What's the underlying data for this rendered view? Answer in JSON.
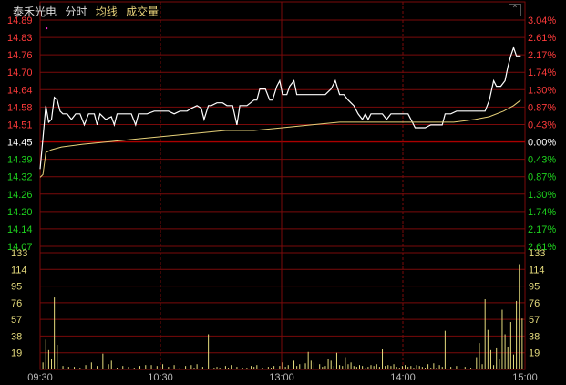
{
  "header": {
    "stock_name": "泰禾光电",
    "mode_label": "分时",
    "avg_label": "均线",
    "vol_label": "成交量",
    "collapse_icon": "chevron-up-icon"
  },
  "colors": {
    "up": "#ff3b3b",
    "down": "#1ed21e",
    "price": "#ffffff",
    "avg": "#e8d27a",
    "vol": "#e6dc7d",
    "grid": "#7a0a0a",
    "dot": "#ff2bd6"
  },
  "chart_data": [
    {
      "type": "line",
      "title": "",
      "ylim": [
        14.01,
        14.89
      ],
      "base": 14.45,
      "price_ticks": [
        "14.89",
        "14.83",
        "14.76",
        "14.70",
        "14.64",
        "14.58",
        "14.51",
        "14.45",
        "14.39",
        "14.32",
        "14.26",
        "14.20",
        "14.14",
        "14.07"
      ],
      "pct_ticks": [
        "3.04%",
        "2.61%",
        "2.17%",
        "1.74%",
        "1.30%",
        "0.87%",
        "0.43%",
        "0.00%",
        "0.43%",
        "0.87%",
        "1.30%",
        "1.74%",
        "2.17%",
        "2.61%"
      ],
      "time_ticks": [
        "09:30",
        "10:30",
        "13:00",
        "14:00",
        "15:00"
      ],
      "series": [
        {
          "name": "",
          "points": [
            [
              0,
              14.35
            ],
            [
              2,
              14.46
            ],
            [
              4,
              14.58
            ],
            [
              6,
              14.52
            ],
            [
              8,
              14.53
            ],
            [
              10,
              14.61
            ],
            [
              12,
              14.6
            ],
            [
              14,
              14.56
            ],
            [
              16,
              14.55
            ],
            [
              19,
              14.55
            ],
            [
              22,
              14.53
            ],
            [
              25,
              14.55
            ],
            [
              28,
              14.55
            ],
            [
              31,
              14.51
            ],
            [
              34,
              14.55
            ],
            [
              38,
              14.55
            ],
            [
              40,
              14.51
            ],
            [
              42,
              14.55
            ],
            [
              46,
              14.53
            ],
            [
              50,
              14.54
            ],
            [
              52,
              14.51
            ],
            [
              54,
              14.55
            ],
            [
              60,
              14.55
            ],
            [
              64,
              14.55
            ],
            [
              67,
              14.51
            ],
            [
              69,
              14.55
            ],
            [
              75,
              14.55
            ],
            [
              80,
              14.56
            ],
            [
              84,
              14.56
            ],
            [
              90,
              14.56
            ],
            [
              94,
              14.55
            ],
            [
              98,
              14.56
            ],
            [
              103,
              14.56
            ],
            [
              106,
              14.57
            ],
            [
              110,
              14.58
            ],
            [
              113,
              14.57
            ],
            [
              115,
              14.53
            ],
            [
              118,
              14.58
            ],
            [
              120,
              14.58
            ],
            [
              124,
              14.59
            ],
            [
              128,
              14.59
            ],
            [
              131,
              14.58
            ],
            [
              135,
              14.58
            ],
            [
              138,
              14.51
            ],
            [
              140,
              14.58
            ],
            [
              145,
              14.58
            ],
            [
              150,
              14.6
            ],
            [
              152,
              14.6
            ],
            [
              154,
              14.64
            ],
            [
              158,
              14.64
            ],
            [
              161,
              14.6
            ],
            [
              163,
              14.6
            ],
            [
              166,
              14.65
            ],
            [
              168,
              14.67
            ],
            [
              170,
              14.62
            ],
            [
              173,
              14.62
            ],
            [
              175,
              14.65
            ],
            [
              178,
              14.67
            ],
            [
              180,
              14.62
            ],
            [
              182,
              14.62
            ],
            [
              186,
              14.62
            ],
            [
              190,
              14.62
            ],
            [
              195,
              14.62
            ],
            [
              200,
              14.62
            ],
            [
              204,
              14.64
            ],
            [
              207,
              14.67
            ],
            [
              210,
              14.62
            ],
            [
              213,
              14.62
            ],
            [
              216,
              14.6
            ],
            [
              220,
              14.58
            ],
            [
              223,
              14.55
            ],
            [
              226,
              14.53
            ],
            [
              228,
              14.55
            ],
            [
              230,
              14.53
            ],
            [
              232,
              14.55
            ],
            [
              235,
              14.55
            ],
            [
              240,
              14.55
            ],
            [
              243,
              14.53
            ],
            [
              246,
              14.55
            ],
            [
              250,
              14.55
            ],
            [
              254,
              14.55
            ],
            [
              258,
              14.55
            ],
            [
              261,
              14.52
            ],
            [
              263,
              14.5
            ],
            [
              266,
              14.5
            ],
            [
              270,
              14.5
            ],
            [
              274,
              14.51
            ],
            [
              278,
              14.51
            ],
            [
              282,
              14.51
            ],
            [
              284,
              14.55
            ],
            [
              288,
              14.55
            ],
            [
              292,
              14.56
            ],
            [
              296,
              14.56
            ],
            [
              300,
              14.56
            ],
            [
              304,
              14.56
            ],
            [
              308,
              14.56
            ],
            [
              312,
              14.56
            ],
            [
              315,
              14.6
            ],
            [
              318,
              14.67
            ],
            [
              320,
              14.65
            ],
            [
              323,
              14.65
            ],
            [
              326,
              14.67
            ],
            [
              328,
              14.72
            ],
            [
              330,
              14.76
            ],
            [
              332,
              14.79
            ],
            [
              334,
              14.76
            ],
            [
              337,
              14.76
            ]
          ],
          "color": "#ffffff"
        },
        {
          "name": "均线",
          "points": [
            [
              0,
              14.32
            ],
            [
              2,
              14.33
            ],
            [
              4,
              14.41
            ],
            [
              8,
              14.42
            ],
            [
              15,
              14.43
            ],
            [
              30,
              14.44
            ],
            [
              50,
              14.45
            ],
            [
              70,
              14.46
            ],
            [
              90,
              14.47
            ],
            [
              110,
              14.48
            ],
            [
              130,
              14.49
            ],
            [
              150,
              14.49
            ],
            [
              170,
              14.5
            ],
            [
              190,
              14.51
            ],
            [
              210,
              14.52
            ],
            [
              230,
              14.52
            ],
            [
              250,
              14.52
            ],
            [
              270,
              14.52
            ],
            [
              290,
              14.52
            ],
            [
              305,
              14.53
            ],
            [
              315,
              14.54
            ],
            [
              325,
              14.56
            ],
            [
              332,
              14.58
            ],
            [
              337,
              14.6
            ]
          ],
          "color": "#e8d27a"
        }
      ],
      "marker": {
        "x": 2,
        "y": 14.86
      }
    },
    {
      "type": "bar",
      "title": "",
      "name": "成交量",
      "ylim": [
        0,
        133
      ],
      "y_ticks": [
        "133",
        "114",
        "95",
        "76",
        "57",
        "38",
        "19"
      ],
      "x_range": [
        0,
        340
      ],
      "bars": [
        [
          2,
          8
        ],
        [
          4,
          34
        ],
        [
          6,
          22
        ],
        [
          8,
          12
        ],
        [
          10,
          82
        ],
        [
          12,
          28
        ],
        [
          16,
          4
        ],
        [
          20,
          3
        ],
        [
          24,
          3
        ],
        [
          28,
          2
        ],
        [
          32,
          5
        ],
        [
          36,
          8
        ],
        [
          40,
          4
        ],
        [
          44,
          18
        ],
        [
          48,
          6
        ],
        [
          50,
          10
        ],
        [
          54,
          2
        ],
        [
          58,
          4
        ],
        [
          62,
          3
        ],
        [
          66,
          2
        ],
        [
          70,
          4
        ],
        [
          74,
          5
        ],
        [
          78,
          5
        ],
        [
          82,
          4
        ],
        [
          86,
          6
        ],
        [
          90,
          3
        ],
        [
          94,
          5
        ],
        [
          98,
          2
        ],
        [
          102,
          4
        ],
        [
          106,
          5
        ],
        [
          108,
          2
        ],
        [
          110,
          6
        ],
        [
          114,
          3
        ],
        [
          118,
          40
        ],
        [
          122,
          2
        ],
        [
          124,
          3
        ],
        [
          126,
          2
        ],
        [
          130,
          4
        ],
        [
          132,
          2
        ],
        [
          134,
          5
        ],
        [
          138,
          3
        ],
        [
          142,
          2
        ],
        [
          145,
          2
        ],
        [
          148,
          4
        ],
        [
          150,
          3
        ],
        [
          152,
          5
        ],
        [
          156,
          2
        ],
        [
          160,
          3
        ],
        [
          162,
          2
        ],
        [
          164,
          4
        ],
        [
          168,
          4
        ],
        [
          170,
          8
        ],
        [
          172,
          3
        ],
        [
          174,
          5
        ],
        [
          178,
          10
        ],
        [
          180,
          4
        ],
        [
          182,
          6
        ],
        [
          186,
          7
        ],
        [
          188,
          20
        ],
        [
          190,
          10
        ],
        [
          192,
          8
        ],
        [
          196,
          6
        ],
        [
          198,
          3
        ],
        [
          200,
          4
        ],
        [
          202,
          12
        ],
        [
          204,
          10
        ],
        [
          206,
          4
        ],
        [
          208,
          19
        ],
        [
          210,
          5
        ],
        [
          212,
          4
        ],
        [
          214,
          14
        ],
        [
          216,
          6
        ],
        [
          218,
          8
        ],
        [
          220,
          4
        ],
        [
          222,
          3
        ],
        [
          224,
          5
        ],
        [
          226,
          4
        ],
        [
          228,
          2
        ],
        [
          230,
          3
        ],
        [
          232,
          5
        ],
        [
          234,
          4
        ],
        [
          236,
          6
        ],
        [
          238,
          3
        ],
        [
          240,
          23
        ],
        [
          242,
          4
        ],
        [
          244,
          5
        ],
        [
          246,
          4
        ],
        [
          248,
          6
        ],
        [
          250,
          3
        ],
        [
          252,
          2
        ],
        [
          254,
          4
        ],
        [
          256,
          5
        ],
        [
          258,
          3
        ],
        [
          260,
          4
        ],
        [
          262,
          2
        ],
        [
          264,
          5
        ],
        [
          266,
          4
        ],
        [
          268,
          3
        ],
        [
          270,
          2
        ],
        [
          272,
          6
        ],
        [
          274,
          2
        ],
        [
          276,
          7
        ],
        [
          278,
          2
        ],
        [
          280,
          5
        ],
        [
          282,
          3
        ],
        [
          284,
          44
        ],
        [
          286,
          2
        ],
        [
          288,
          3
        ],
        [
          292,
          4
        ],
        [
          298,
          3
        ],
        [
          302,
          2
        ],
        [
          306,
          14
        ],
        [
          308,
          30
        ],
        [
          310,
          6
        ],
        [
          312,
          80
        ],
        [
          314,
          45
        ],
        [
          316,
          22
        ],
        [
          318,
          5
        ],
        [
          320,
          25
        ],
        [
          322,
          12
        ],
        [
          324,
          68
        ],
        [
          326,
          40
        ],
        [
          328,
          26
        ],
        [
          330,
          54
        ],
        [
          332,
          17
        ],
        [
          334,
          78
        ],
        [
          336,
          120
        ],
        [
          338,
          58
        ]
      ]
    }
  ]
}
